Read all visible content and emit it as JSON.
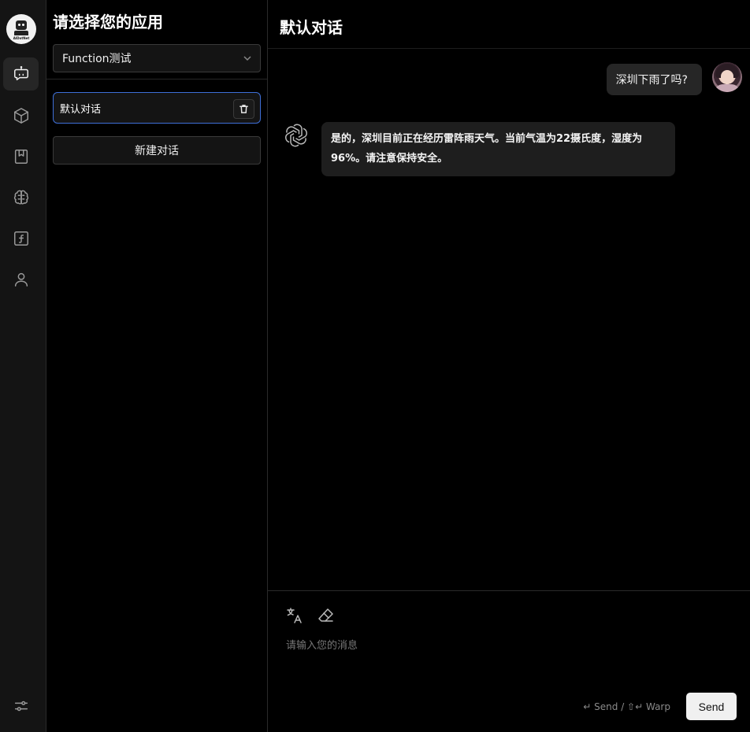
{
  "rail": {
    "logo_text": "AIDotNet",
    "items": [
      {
        "name": "chat",
        "icon": "chat-bot-icon",
        "active": true
      },
      {
        "name": "apps",
        "icon": "cube-icon",
        "active": false
      },
      {
        "name": "knowledge",
        "icon": "bookmark-book-icon",
        "active": false
      },
      {
        "name": "models",
        "icon": "brain-icon",
        "active": false
      },
      {
        "name": "functions",
        "icon": "function-icon",
        "active": false
      },
      {
        "name": "user",
        "icon": "user-icon",
        "active": false
      }
    ],
    "settings_icon": "sliders-icon"
  },
  "panel": {
    "title": "请选择您的应用",
    "selected_app": "Function测试",
    "conversations": [
      {
        "label": "默认对话",
        "active": true
      }
    ],
    "new_conversation_label": "新建对话"
  },
  "chat": {
    "title": "默认对话",
    "messages": [
      {
        "role": "user",
        "text": "深圳下雨了吗?"
      },
      {
        "role": "assistant",
        "text": "是的，深圳目前正在经历雷阵雨天气。当前气温为22摄氏度，湿度为96%。请注意保持安全。"
      }
    ],
    "input": {
      "placeholder": "请输入您的消息",
      "value": ""
    },
    "hint": "↵ Send / ⇧↵ Warp",
    "send_label": "Send"
  },
  "colors": {
    "accent_border": "#3e6fd8",
    "background": "#000000",
    "rail_bg": "#141414"
  }
}
